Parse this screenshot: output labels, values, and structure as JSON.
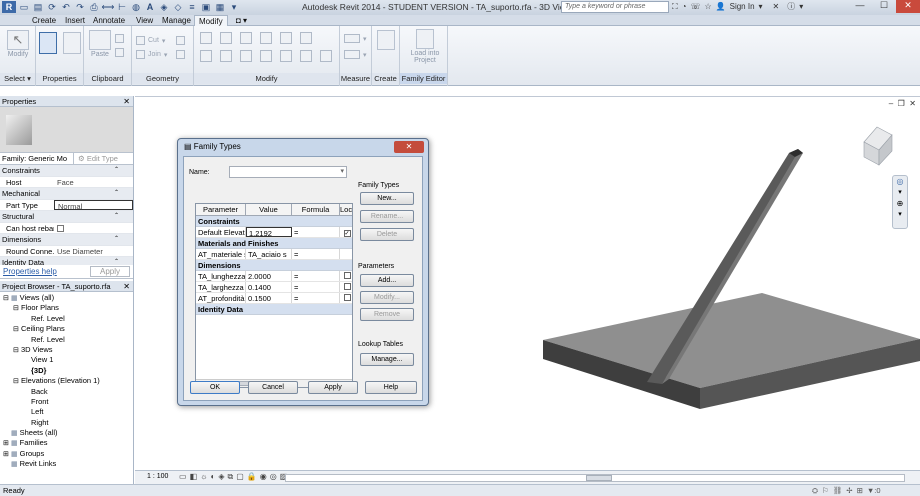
{
  "window": {
    "title": "Autodesk Revit 2014 -  STUDENT VERSION -    TA_suporto.rfa - 3D View: {3D}",
    "search_placeholder": "Type a keyword or phrase",
    "sign_in": "Sign In"
  },
  "tabs": [
    "Create",
    "Insert",
    "Annotate",
    "View",
    "Manage",
    "Modify"
  ],
  "active_tab": "Modify",
  "ribbon": {
    "panels": [
      {
        "label": "Select",
        "dropdown": true
      },
      {
        "label": "Properties"
      },
      {
        "label": "Clipboard"
      },
      {
        "label": "Geometry"
      },
      {
        "label": "Modify"
      },
      {
        "label": "Measure"
      },
      {
        "label": "Create"
      },
      {
        "label": "Family Editor"
      }
    ],
    "modify_btn": "Modify",
    "paste_btn": "Paste",
    "cut": "Cut",
    "join": "Join",
    "load_into": "Load into",
    "project": "Project"
  },
  "properties": {
    "title": "Properties",
    "family": "Family: Generic Mo",
    "edit_type": "Edit Type",
    "rows": [
      {
        "type": "cat",
        "label": "Constraints"
      },
      {
        "type": "row",
        "k": "Host",
        "v": "Face"
      },
      {
        "type": "cat",
        "label": "Mechanical"
      },
      {
        "type": "row",
        "k": "Part Type",
        "v": "Normal"
      },
      {
        "type": "cat",
        "label": "Structural"
      },
      {
        "type": "row",
        "k": "Can host rebar",
        "v": ""
      },
      {
        "type": "cat",
        "label": "Dimensions"
      },
      {
        "type": "row",
        "k": "Round Conne...",
        "v": "Use Diameter"
      },
      {
        "type": "cat",
        "label": "Identity Data"
      }
    ],
    "help": "Properties help",
    "apply": "Apply"
  },
  "browser": {
    "title": "Project Browser - TA_suporto.rfa",
    "items": [
      {
        "label": "Views (all)",
        "indent": 0,
        "bold": false,
        "exp": "-"
      },
      {
        "label": "Floor Plans",
        "indent": 1,
        "bold": false,
        "exp": "-"
      },
      {
        "label": "Ref. Level",
        "indent": 2,
        "bold": false,
        "exp": ""
      },
      {
        "label": "Ceiling Plans",
        "indent": 1,
        "bold": false,
        "exp": "-"
      },
      {
        "label": "Ref. Level",
        "indent": 2,
        "bold": false,
        "exp": ""
      },
      {
        "label": "3D Views",
        "indent": 1,
        "bold": false,
        "exp": "-"
      },
      {
        "label": "View 1",
        "indent": 2,
        "bold": false,
        "exp": ""
      },
      {
        "label": "{3D}",
        "indent": 2,
        "bold": true,
        "exp": ""
      },
      {
        "label": "Elevations (Elevation 1)",
        "indent": 1,
        "bold": false,
        "exp": "-"
      },
      {
        "label": "Back",
        "indent": 2,
        "bold": false,
        "exp": ""
      },
      {
        "label": "Front",
        "indent": 2,
        "bold": false,
        "exp": ""
      },
      {
        "label": "Left",
        "indent": 2,
        "bold": false,
        "exp": ""
      },
      {
        "label": "Right",
        "indent": 2,
        "bold": false,
        "exp": ""
      },
      {
        "label": "Sheets (all)",
        "indent": 0,
        "bold": false,
        "exp": ""
      },
      {
        "label": "Families",
        "indent": 0,
        "bold": false,
        "exp": "+"
      },
      {
        "label": "Groups",
        "indent": 0,
        "bold": false,
        "exp": "+"
      },
      {
        "label": "Revit Links",
        "indent": 0,
        "bold": false,
        "exp": ""
      }
    ]
  },
  "dialog": {
    "title": "Family Types",
    "name_label": "Name:",
    "family_types_label": "Family Types",
    "new_btn": "New...",
    "rename_btn": "Rename...",
    "delete_btn": "Delete",
    "parameters_label": "Parameters",
    "add_btn": "Add...",
    "modify_btn": "Modify...",
    "remove_btn": "Remove",
    "lookup_label": "Lookup Tables",
    "manage_btn": "Manage...",
    "ok": "OK",
    "cancel": "Cancel",
    "apply": "Apply",
    "help": "Help",
    "columns": [
      "Parameter",
      "Value",
      "Formula",
      "Loc"
    ],
    "sections": [
      {
        "title": "Constraints",
        "rows": [
          {
            "p": "Default Elevati",
            "v": "1.2192",
            "f": "=",
            "lock": true
          }
        ]
      },
      {
        "title": "Materials and Finishes",
        "rows": [
          {
            "p": "AT_materiale s",
            "v": "TA_aciaio s",
            "f": "=",
            "lock": null
          }
        ]
      },
      {
        "title": "Dimensions",
        "rows": [
          {
            "p": "TA_lunghezza",
            "v": "2.0000",
            "f": "=",
            "lock": false
          },
          {
            "p": "TA_larghezza s",
            "v": "0.1400",
            "f": "=",
            "lock": false
          },
          {
            "p": "AT_profondità",
            "v": "0.1500",
            "f": "=",
            "lock": false
          }
        ]
      },
      {
        "title": "Identity Data",
        "rows": []
      }
    ]
  },
  "viewbar": {
    "scale": "1 : 100"
  },
  "status": {
    "text": "Ready",
    "filter": ":0"
  }
}
